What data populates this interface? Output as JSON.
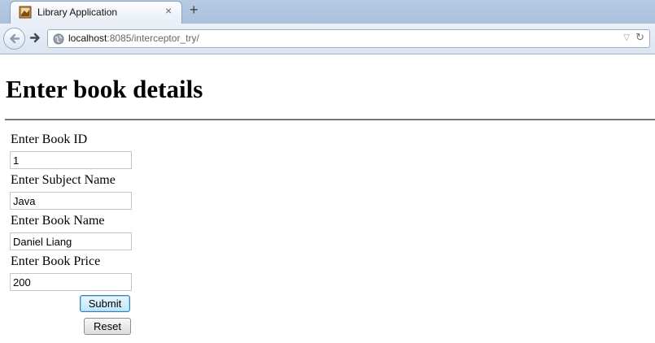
{
  "browser": {
    "tab_title": "Library Application",
    "tab_close": "×",
    "new_tab": "+",
    "url_host": "localhost",
    "url_rest": ":8085/interceptor_try/"
  },
  "page": {
    "heading": "Enter book details",
    "form": {
      "fields": [
        {
          "label": "Enter Book ID",
          "value": "1"
        },
        {
          "label": "Enter Subject Name",
          "value": "Java"
        },
        {
          "label": "Enter Book Name",
          "value": "Daniel Liang"
        },
        {
          "label": "Enter Book Price",
          "value": "200"
        }
      ],
      "submit_label": "Submit",
      "reset_label": "Reset"
    }
  },
  "colors": {
    "tabbar": "#b7cbe4",
    "navbar": "#dbe4f0",
    "submit_focus": "#3c7fb1"
  },
  "icons": {
    "tab": "library-favicon",
    "back": "back-arrow-icon",
    "forward": "forward-arrow-icon",
    "site": "globe-icon",
    "dropdown": "chevron-down-icon",
    "reload": "reload-icon"
  }
}
